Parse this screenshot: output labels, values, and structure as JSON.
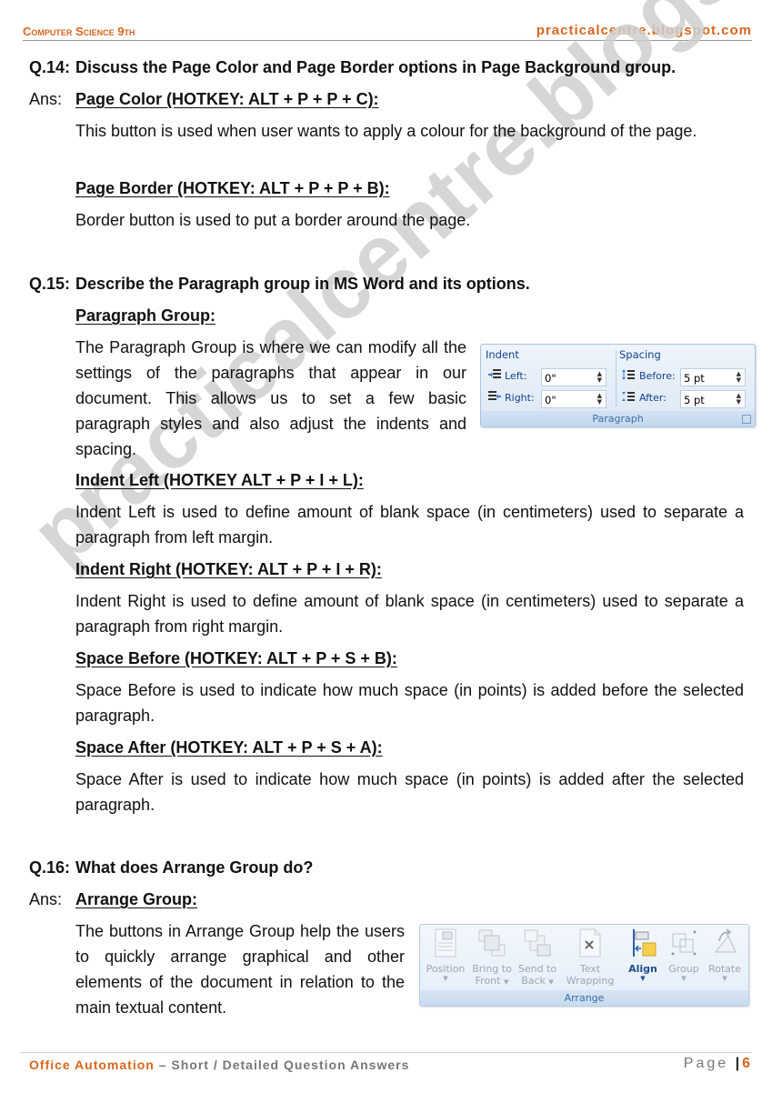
{
  "header": {
    "subject": "Computer Science 9th",
    "site": "practicalcentre.blogspot.com"
  },
  "watermark": "practicalcentre.blogspot.com",
  "questions": [
    {
      "number": "Q.14:",
      "title": "Discuss the Page Color and Page Border options in Page Background group.",
      "ans_label": "Ans:",
      "sections": [
        {
          "heading": "Page Color (HOTKEY: ALT + P + P + C):",
          "text": "This button is used when user wants to apply a colour for the background of the page."
        },
        {
          "heading": "Page Border (HOTKEY: ALT + P + P + B):",
          "text": "Border button is used to put a border around the page."
        }
      ]
    },
    {
      "number": "Q.15:",
      "title": "Describe the Paragraph group in MS Word and its options.",
      "sections": [
        {
          "heading": "Paragraph Group:",
          "text": "The Paragraph Group is where we can modify all the settings of the paragraphs that appear in our document. This allows us to set a few basic paragraph styles and also adjust the indents and spacing."
        },
        {
          "heading": "Indent Left (HOTKEY ALT + P + I + L):",
          "text": "Indent Left is used to define amount of blank space (in centimeters) used to separate a paragraph from left margin."
        },
        {
          "heading": "Indent Right (HOTKEY: ALT + P + I + R):",
          "text": "Indent Right is used to define amount of blank space (in centimeters) used to separate a paragraph from right margin."
        },
        {
          "heading": "Space Before (HOTKEY: ALT + P + S + B):",
          "text": "Space Before is used to indicate how much space (in points) is added before the selected paragraph."
        },
        {
          "heading": "Space After (HOTKEY: ALT + P + S + A):",
          "text": "Space After is used to indicate how much space (in points) is added after the selected paragraph."
        }
      ]
    },
    {
      "number": "Q.16:",
      "title": "What does Arrange Group do?",
      "ans_label": "Ans:",
      "sections": [
        {
          "heading": "Arrange Group:",
          "text": "The buttons in Arrange Group help the users to quickly arrange graphical and other elements of the document in relation to the main textual content."
        }
      ]
    }
  ],
  "paragraph_widget": {
    "indent_label": "Indent",
    "spacing_label": "Spacing",
    "left_label": "Left:",
    "left_value": "0\"",
    "right_label": "Right:",
    "right_value": "0\"",
    "before_label": "Before:",
    "before_value": "5 pt",
    "after_label": "After:",
    "after_value": "5 pt",
    "group_label": "Paragraph"
  },
  "arrange_widget": {
    "buttons": [
      {
        "line1": "Position",
        "line2": ""
      },
      {
        "line1": "Bring to",
        "line2": "Front"
      },
      {
        "line1": "Send to",
        "line2": "Back"
      },
      {
        "line1": "Text",
        "line2": "Wrapping"
      },
      {
        "line1": "Align",
        "line2": ""
      },
      {
        "line1": "Group",
        "line2": ""
      },
      {
        "line1": "Rotate",
        "line2": ""
      }
    ],
    "group_label": "Arrange"
  },
  "footer": {
    "title": "Office Automation",
    "subtitle": "– Short / Detailed Question Answers",
    "page_label": "Page",
    "page_number": "6"
  },
  "colors": {
    "accent_orange": "#d9651e",
    "watermark_gray": "#cfcfcf",
    "ribbon_blue": "#15428b"
  }
}
